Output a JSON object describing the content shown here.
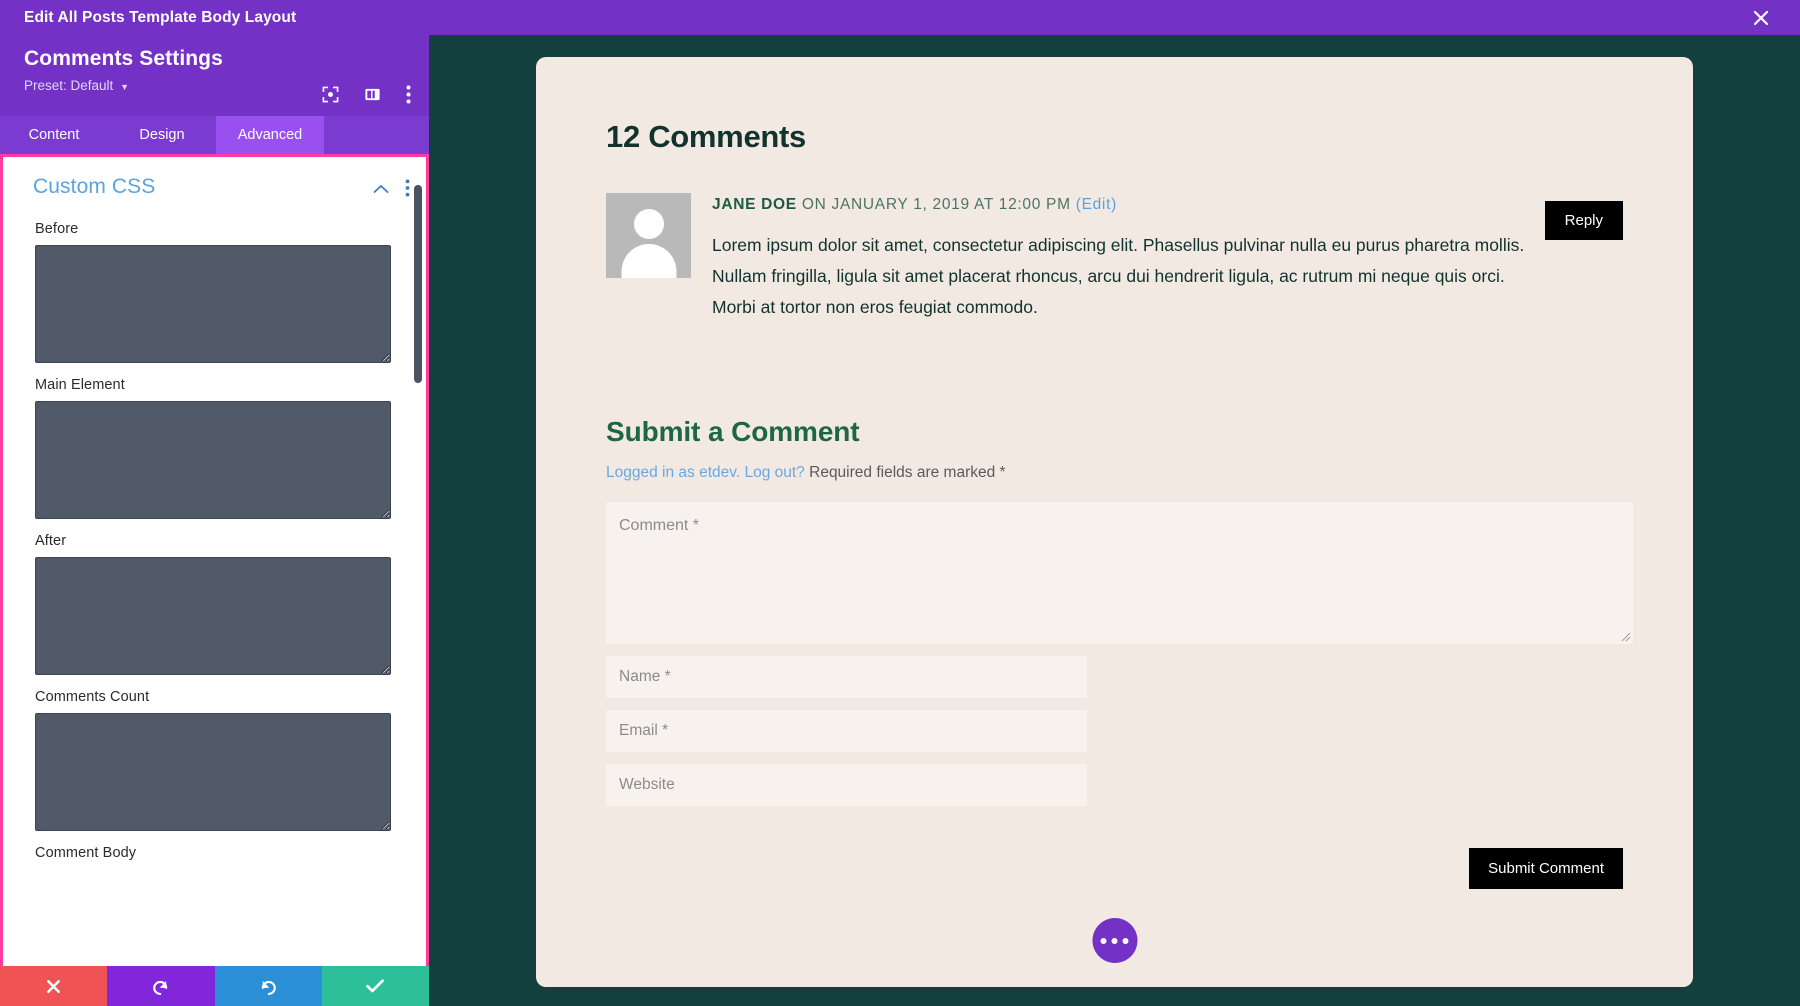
{
  "top_bar": {
    "title": "Edit All Posts Template Body Layout",
    "close_icon": "close-icon"
  },
  "settings_panel": {
    "title": "Comments Settings",
    "preset": "Preset: Default",
    "header_icons": [
      "target-focus-icon",
      "layout-columns-icon",
      "vertical-dots-icon"
    ],
    "tabs": [
      {
        "label": "Content",
        "active": false
      },
      {
        "label": "Design",
        "active": false
      },
      {
        "label": "Advanced",
        "active": true
      }
    ],
    "section": {
      "title": "Custom CSS",
      "collapse_icon": "chevron-up-icon",
      "menu_icon": "vertical-dots-icon",
      "fields": [
        {
          "label": "Before",
          "value": ""
        },
        {
          "label": "Main Element",
          "value": ""
        },
        {
          "label": "After",
          "value": ""
        },
        {
          "label": "Comments Count",
          "value": ""
        },
        {
          "label": "Comment Body",
          "value": ""
        }
      ]
    },
    "actions": [
      {
        "name": "cancel",
        "icon": "close-icon",
        "color": "#ef5353"
      },
      {
        "name": "undo",
        "icon": "undo-icon",
        "color": "#8126da"
      },
      {
        "name": "redo",
        "icon": "redo-icon",
        "color": "#2a8fd6"
      },
      {
        "name": "save",
        "icon": "check-icon",
        "color": "#2cbf9a"
      }
    ]
  },
  "preview": {
    "comments_title": "12 Comments",
    "comment": {
      "author": "JANE DOE",
      "meta_on": " ON JANUARY 1, 2019 AT 12:00 PM ",
      "edit_link": "(Edit)",
      "body": "Lorem ipsum dolor sit amet, consectetur adipiscing elit. Phasellus pulvinar nulla eu purus pharetra mollis. Nullam fringilla, ligula sit amet placerat rhoncus, arcu dui hendrerit ligula, ac rutrum mi neque quis orci. Morbi at tortor non eros feugiat commodo.",
      "reply_label": "Reply"
    },
    "form": {
      "heading": "Submit a Comment",
      "logged_in_text": "Logged in as etdev.",
      "logout_text": "Log out?",
      "required_text": "Required fields are marked *",
      "comment_placeholder": "Comment *",
      "name_placeholder": "Name *",
      "email_placeholder": "Email *",
      "website_placeholder": "Website",
      "submit_label": "Submit Comment"
    },
    "fab_icon": "ellipsis-icon"
  },
  "colors": {
    "brand_purple": "#7331c6",
    "tab_active": "#9a4ff0",
    "highlight_pink": "#ff3ba0",
    "canvas_dark": "#13403f",
    "card_bg": "#f3e9e3",
    "textarea_fill": "#515a68"
  }
}
